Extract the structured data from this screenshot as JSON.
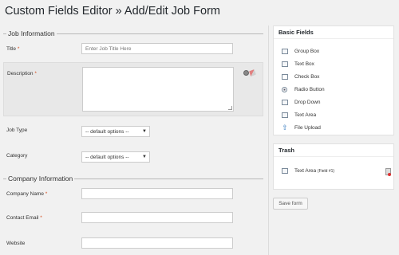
{
  "page": {
    "title": "Custom Fields Editor » Add/Edit Job Form"
  },
  "groups": {
    "job_information": {
      "legend": "Job Information",
      "title_label": "Title",
      "title_placeholder": "Enter Job Title Here",
      "description_label": "Description",
      "job_type_label": "Job Type",
      "job_type_value": "-- default options --",
      "category_label": "Category",
      "category_value": "-- default options --"
    },
    "company_information": {
      "legend": "Company Information",
      "company_name_label": "Company Name",
      "contact_email_label": "Contact Email",
      "website_label": "Website"
    }
  },
  "required_marker": "*",
  "select_arrow": "▼",
  "sidebar": {
    "basic_fields": {
      "title": "Basic Fields",
      "items": [
        {
          "label": "Group Box",
          "icon": "group-box-icon"
        },
        {
          "label": "Text Box",
          "icon": "text-box-icon"
        },
        {
          "label": "Check Box",
          "icon": "check-box-icon"
        },
        {
          "label": "Radio Button",
          "icon": "radio-button-icon"
        },
        {
          "label": "Drop Down",
          "icon": "drop-down-icon"
        },
        {
          "label": "Text Area",
          "icon": "text-area-icon"
        },
        {
          "label": "File Upload",
          "icon": "file-upload-icon"
        }
      ]
    },
    "trash": {
      "title": "Trash",
      "item_label": "Text Area",
      "item_meta": "(Field #1)"
    }
  },
  "save_button": "Save form",
  "colors": {
    "required": "#d54e21",
    "background": "#f1f1f1",
    "upload_icon": "#3a7ec1"
  }
}
